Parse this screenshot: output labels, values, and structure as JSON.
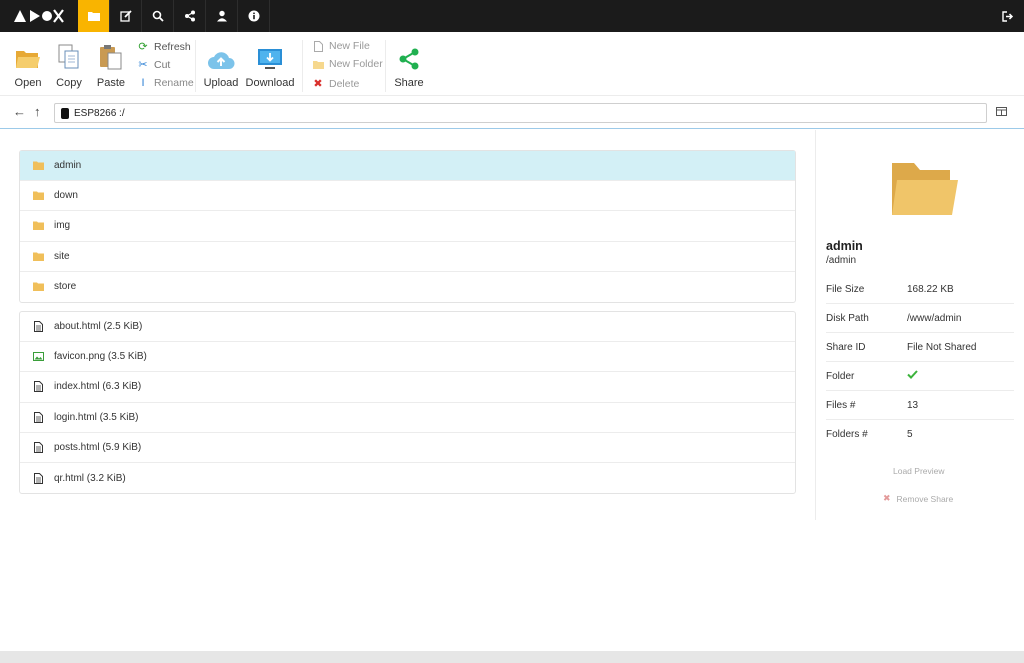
{
  "topbar": {
    "nav": [
      {
        "name": "folder-icon",
        "active": true
      },
      {
        "name": "edit-icon",
        "active": false
      },
      {
        "name": "search-icon",
        "active": false
      },
      {
        "name": "share-icon",
        "active": false
      },
      {
        "name": "user-icon",
        "active": false
      },
      {
        "name": "info-icon",
        "active": false
      }
    ],
    "accent": "#f9b400",
    "logout_icon": "sign-out-icon"
  },
  "toolbar": {
    "open": "Open",
    "copy": "Copy",
    "paste": "Paste",
    "refresh": "Refresh",
    "cut": "Cut",
    "rename": "Rename",
    "upload": "Upload",
    "download": "Download",
    "new_file": "New File",
    "new_folder": "New Folder",
    "delete": "Delete",
    "share": "Share"
  },
  "path": {
    "value": "ESP8266 :/"
  },
  "folders": [
    {
      "name": "admin",
      "selected": true
    },
    {
      "name": "down",
      "selected": false
    },
    {
      "name": "img",
      "selected": false
    },
    {
      "name": "site",
      "selected": false
    },
    {
      "name": "store",
      "selected": false
    }
  ],
  "files": [
    {
      "label": "about.html (2.5 KiB)",
      "icon": "file-text-icon"
    },
    {
      "label": "favicon.png (3.5 KiB)",
      "icon": "image-icon"
    },
    {
      "label": "index.html (6.3 KiB)",
      "icon": "file-text-icon"
    },
    {
      "label": "login.html (3.5 KiB)",
      "icon": "file-text-icon"
    },
    {
      "label": "posts.html (5.9 KiB)",
      "icon": "file-text-icon"
    },
    {
      "label": "qr.html (3.2 KiB)",
      "icon": "file-text-icon"
    }
  ],
  "details": {
    "name": "admin",
    "path": "/admin",
    "props": [
      {
        "label": "File Size",
        "value": "168.22 KB"
      },
      {
        "label": "Disk Path",
        "value": "/www/admin"
      },
      {
        "label": "Share ID",
        "value": "File Not Shared"
      },
      {
        "label": "Folder",
        "value": ""
      },
      {
        "label": "Files #",
        "value": "13"
      },
      {
        "label": "Folders #",
        "value": "5"
      }
    ],
    "load_preview": "Load Preview",
    "remove_share": "Remove Share"
  },
  "colors": {
    "folder": "#f0bf5a",
    "selected_row": "#d3f0f6",
    "check": "#3cb33c",
    "share": "#20b050",
    "delete": "#d9302c",
    "blue": "#2a7fd4"
  }
}
